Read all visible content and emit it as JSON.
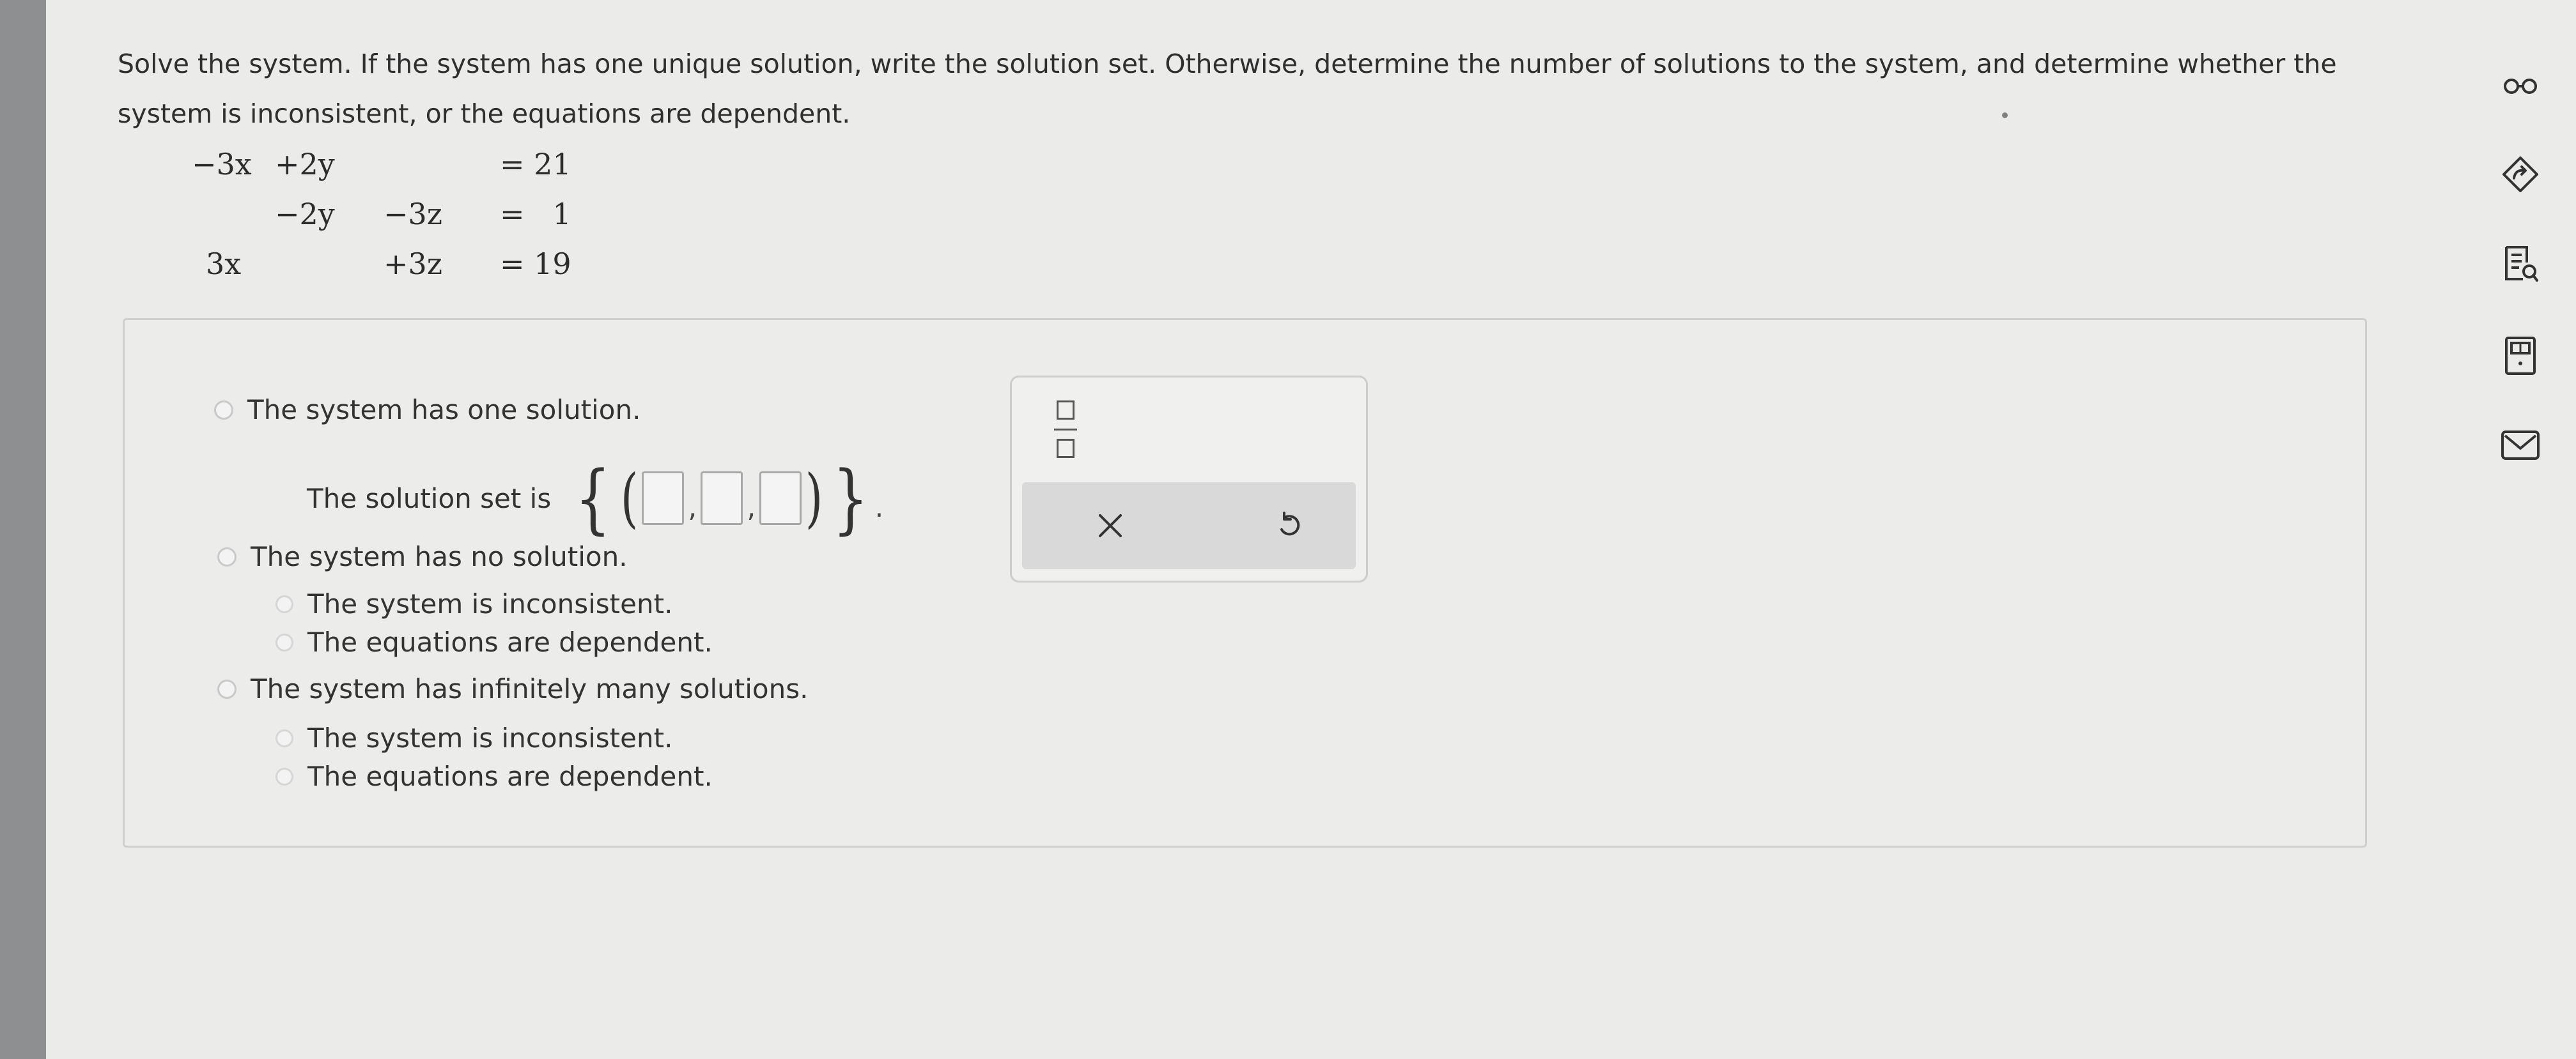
{
  "question": {
    "prompt": "Solve the system. If the system has one unique solution, write the solution set. Otherwise, determine the number of solutions to the system, and determine whether the system is inconsistent, or the equations are dependent."
  },
  "system": {
    "row1": {
      "x": "−3x",
      "y": "+2y",
      "z": "",
      "eq": "= 21"
    },
    "row2": {
      "x": "",
      "y": "−2y",
      "z": "−3z",
      "eq": "=   1"
    },
    "row3": {
      "x": "3x",
      "y": "",
      "z": "+3z",
      "eq": "= 19"
    }
  },
  "options": {
    "one_solution": "The system has one solution.",
    "solution_set_label": "The solution set is",
    "open_brace": "{",
    "close_brace": "}",
    "open_paren": "(",
    "close_paren": ")",
    "comma": ",",
    "period": ".",
    "no_solution": "The system has no solution.",
    "no_sub_inconsistent": "The system is inconsistent.",
    "no_sub_dependent": "The equations are dependent.",
    "infinite_solutions": "The system has infinitely many solutions.",
    "inf_sub_inconsistent": "The system is inconsistent.",
    "inf_sub_dependent": "The equations are dependent."
  },
  "palette": {
    "icons": [
      "fraction-icon",
      "close-icon",
      "undo-icon"
    ]
  },
  "toolbar": {
    "icons": [
      "glasses-icon",
      "hint-arrow-icon",
      "textbook-icon",
      "calculator-icon",
      "mail-icon"
    ]
  },
  "colors": {
    "page_background": "#ebebea",
    "icon_color": "#333333"
  }
}
